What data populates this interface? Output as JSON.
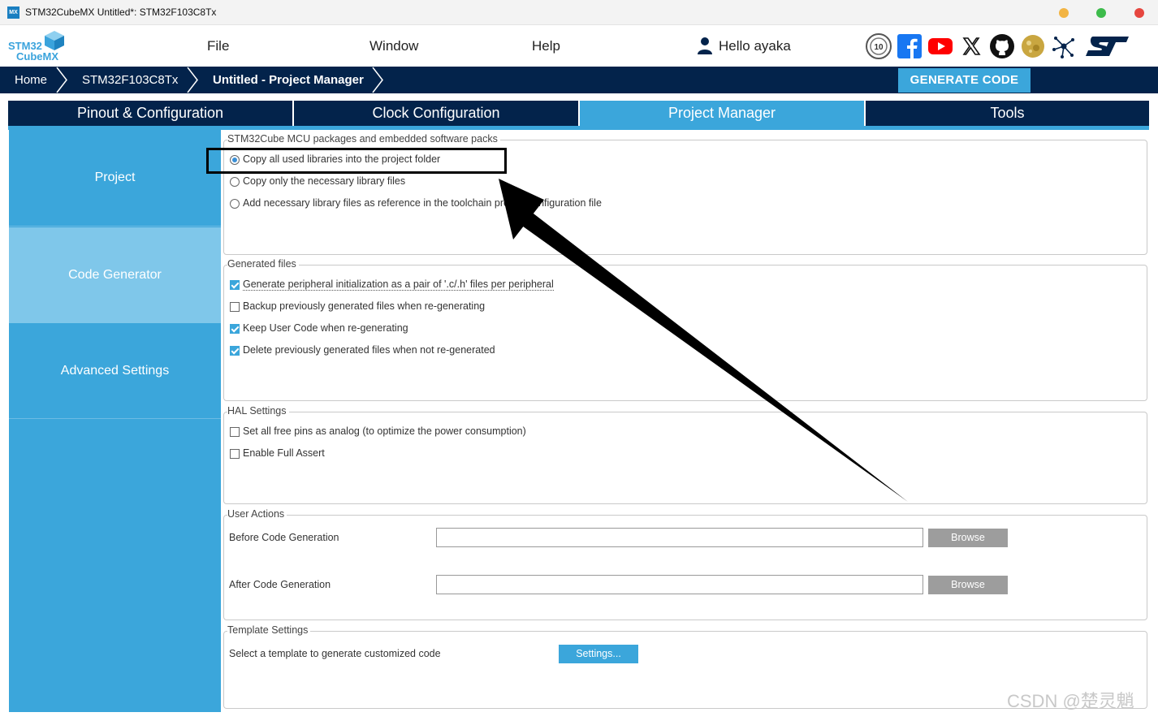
{
  "window": {
    "title": "STM32CubeMX Untitled*: STM32F103C8Tx",
    "app_icon": "MX",
    "controls": [
      "minimize",
      "maximize",
      "close"
    ]
  },
  "menubar": {
    "logo": {
      "line1": "STM32",
      "line2": "CubeMX"
    },
    "items": [
      "File",
      "Window",
      "Help"
    ],
    "user_greeting": "Hello ayaka",
    "social_icons": [
      "anniversary-10-icon",
      "facebook-icon",
      "youtube-icon",
      "x-icon",
      "github-icon",
      "community-icon",
      "network-icon",
      "st-logo-icon"
    ]
  },
  "breadcrumb": {
    "items": [
      "Home",
      "STM32F103C8Tx",
      "Untitled - Project Manager"
    ],
    "generate_label": "GENERATE CODE"
  },
  "tabs": {
    "items": [
      "Pinout & Configuration",
      "Clock Configuration",
      "Project Manager",
      "Tools"
    ],
    "active": "Project Manager"
  },
  "sidebar": {
    "items": [
      "Project",
      "Code Generator",
      "Advanced Settings"
    ],
    "active": "Code Generator"
  },
  "packages": {
    "title": "STM32Cube MCU packages and embedded software packs",
    "options": [
      {
        "label": "Copy all used libraries into the project folder",
        "selected": true
      },
      {
        "label": "Copy only the necessary library files",
        "selected": false
      },
      {
        "label": "Add necessary library files as reference in the toolchain project configuration file",
        "selected": false
      }
    ]
  },
  "generated_files": {
    "title": "Generated files",
    "options": [
      {
        "label": "Generate peripheral initialization as a pair of '.c/.h' files per peripheral",
        "checked": true
      },
      {
        "label": "Backup previously generated files when re-generating",
        "checked": false
      },
      {
        "label": "Keep User Code when re-generating",
        "checked": true
      },
      {
        "label": "Delete previously generated files when not re-generated",
        "checked": true
      }
    ]
  },
  "hal_settings": {
    "title": "HAL Settings",
    "options": [
      {
        "label": "Set all free pins as analog (to optimize the power consumption)",
        "checked": false
      },
      {
        "label": "Enable Full Assert",
        "checked": false
      }
    ]
  },
  "user_actions": {
    "title": "User Actions",
    "before_label": "Before Code Generation",
    "before_value": "",
    "after_label": "After Code Generation",
    "after_value": "",
    "browse_label": "Browse"
  },
  "template_settings": {
    "title": "Template Settings",
    "description": "Select a template to generate customized code",
    "button_label": "Settings..."
  },
  "watermark": "CSDN @楚灵魈",
  "colors": {
    "accent": "#3ba6db",
    "navy": "#03234b",
    "sidebar_active": "#7fc7ea"
  }
}
